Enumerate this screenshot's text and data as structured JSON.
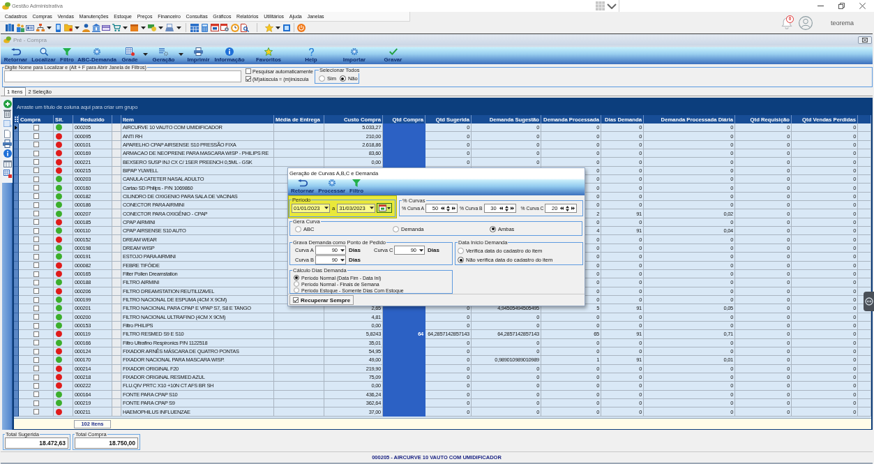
{
  "app": {
    "title": "Gestão Administrativa",
    "menu": [
      "Cadastros",
      "Compras",
      "Vendas",
      "Manutenções",
      "Estoque",
      "Preços",
      "Financeiro",
      "Consultas",
      "Gráficos",
      "Relatórios",
      "Utilitários",
      "Ajuda",
      "Janelas"
    ],
    "notifications": "0",
    "user": "teorema"
  },
  "window": {
    "title": "Pré - Compra",
    "toolbar": [
      {
        "label": "Retornar",
        "dropdown": false
      },
      {
        "label": "Localizar",
        "dropdown": false
      },
      {
        "label": "Filtro",
        "dropdown": false
      },
      {
        "label": "ABC-Demanda",
        "dropdown": false
      },
      {
        "label": "Grade",
        "dropdown": true
      },
      {
        "label": "Geração",
        "dropdown": true
      },
      {
        "label": "Imprimir",
        "dropdown": false
      },
      {
        "label": "Informação",
        "dropdown": false
      },
      {
        "label": "Favoritos",
        "dropdown": false
      },
      {
        "label": "Help",
        "dropdown": false
      },
      {
        "label": "Importar",
        "dropdown": false
      },
      {
        "label": "Gravar",
        "dropdown": false
      }
    ],
    "search": {
      "label": "Digite Nome para Localizar e (Alt + F para Abrir Janela de Filtros)"
    },
    "options": [
      {
        "label": "Pesquisar automaticamente",
        "checked": false
      },
      {
        "label": "(M)aiúscula = (m)inúscula",
        "checked": true
      }
    ],
    "select_all": {
      "title": "Selecionar Todos",
      "options": [
        {
          "label": "Sim",
          "selected": false
        },
        {
          "label": "Não",
          "selected": true
        }
      ]
    },
    "tabs": [
      {
        "label": "1 Itens",
        "selected": true
      },
      {
        "label": "2 Seleção",
        "selected": false
      }
    ],
    "grid": {
      "group_hint": "Arraste um título de coluna aqui para criar um grupo",
      "columns": [
        "Compra",
        "Sit.",
        "Reduzido",
        "Item",
        "Média de Entrega",
        "Custo Compra",
        "Qtd Compra",
        "Qtd Sugerida",
        "Demanda Sugestão",
        "Demanda Processada",
        "Dias Demanda",
        "Demanda Processada Diária",
        "Qtd Requisição",
        "Qtd Vendas Perdidas"
      ],
      "rows": [
        {
          "selected": true,
          "checked": false,
          "color": "#3cae2c",
          "cells": [
            "",
            "",
            "000205",
            "AIRCURVE 10 VAUTO COM UMIDIFICADOR",
            "",
            "5.033,27",
            "",
            "0",
            "0",
            "0",
            "0",
            "0",
            "0",
            "0"
          ]
        },
        {
          "selected": false,
          "checked": false,
          "color": "#e01b1b",
          "cells": [
            "",
            "",
            "000095",
            "ANTI RH",
            "",
            "210,00",
            "",
            "0",
            "0",
            "0",
            "0",
            "0",
            "0",
            "0"
          ]
        },
        {
          "selected": false,
          "checked": false,
          "color": "#e01b1b",
          "cells": [
            "",
            "",
            "000101",
            "APARELHO CPAP AIRSENSE S10 PRESSÃO FIXA",
            "",
            "2.618,86",
            "",
            "0",
            "0",
            "0",
            "0",
            "0",
            "0",
            "0"
          ]
        },
        {
          "selected": false,
          "checked": false,
          "color": "#e01b1b",
          "cells": [
            "",
            "",
            "000169",
            "ARMACAO DE NEOPRENE PARA MASCARA WISP - PHILIPS RE",
            "",
            "83,60",
            "",
            "0",
            "0",
            "0",
            "0",
            "0",
            "0",
            "0"
          ]
        },
        {
          "selected": false,
          "checked": false,
          "color": "#e01b1b",
          "cells": [
            "",
            "",
            "000221",
            "BEXSERO SUSP INJ CX C/ 1SER PREENCH 0,5ML - GSK",
            "",
            "0,00",
            "",
            "0",
            "0",
            "0",
            "0",
            "0",
            "0",
            "0"
          ]
        },
        {
          "selected": false,
          "checked": false,
          "color": "#e01b1b",
          "cells": [
            "",
            "",
            "000215",
            "BIPAP YUWELL",
            "",
            "",
            "",
            "",
            "",
            "0",
            "0",
            "0",
            "0",
            "0"
          ]
        },
        {
          "selected": false,
          "checked": false,
          "color": "#3cae2c",
          "cells": [
            "",
            "",
            "000203",
            "CANULA CATETER NASAL ADULTO",
            "",
            "",
            "",
            "",
            "",
            "0",
            "0",
            "0",
            "0",
            "0"
          ]
        },
        {
          "selected": false,
          "checked": false,
          "color": "#3cae2c",
          "cells": [
            "",
            "",
            "000160",
            "Cartao SD Philips - P/N 1069860",
            "",
            "",
            "",
            "",
            "",
            "0",
            "0",
            "0",
            "0",
            "0"
          ]
        },
        {
          "selected": false,
          "checked": false,
          "color": "#3cae2c",
          "cells": [
            "",
            "",
            "000182",
            "CILINDRO DE OXIGENIO PARA SALA DE VACINAS",
            "",
            "",
            "",
            "",
            "",
            "0",
            "0",
            "0",
            "0",
            "0"
          ]
        },
        {
          "selected": false,
          "checked": false,
          "color": "#3cae2c",
          "cells": [
            "",
            "",
            "000186",
            "CONECTOR PARA AIRMINI",
            "",
            "",
            "",
            "",
            "",
            "0",
            "0",
            "0",
            "0",
            "0"
          ]
        },
        {
          "selected": false,
          "checked": false,
          "color": "#3cae2c",
          "cells": [
            "",
            "",
            "000207",
            "CONECTOR PARA OXIGÊNIO - CPAP",
            "",
            "",
            "",
            "",
            "",
            "2",
            "91",
            "0,02",
            "0",
            "0"
          ]
        },
        {
          "selected": false,
          "checked": false,
          "color": "#e01b1b",
          "cells": [
            "",
            "",
            "000185",
            "CPAP AIRMINI",
            "",
            "",
            "",
            "",
            "",
            "0",
            "0",
            "0",
            "0",
            "0"
          ]
        },
        {
          "selected": false,
          "checked": false,
          "color": "#3cae2c",
          "cells": [
            "",
            "",
            "000110",
            "CPAP AIRSENSE S10 AUTO",
            "",
            "",
            "",
            "",
            "",
            "4",
            "91",
            "0,04",
            "0",
            "0"
          ]
        },
        {
          "selected": false,
          "checked": false,
          "color": "#e01b1b",
          "cells": [
            "",
            "",
            "000152",
            "DREAM WEAR",
            "",
            "",
            "",
            "",
            "",
            "0",
            "0",
            "0",
            "0",
            "0"
          ]
        },
        {
          "selected": false,
          "checked": false,
          "color": "#3cae2c",
          "cells": [
            "",
            "",
            "000198",
            "DREAM WISP",
            "",
            "",
            "",
            "",
            "",
            "0",
            "0",
            "0",
            "0",
            "0"
          ]
        },
        {
          "selected": false,
          "checked": false,
          "color": "#3cae2c",
          "cells": [
            "",
            "",
            "000191",
            "ESTOJO PARA AIRMINI",
            "",
            "",
            "",
            "",
            "",
            "0",
            "0",
            "0",
            "0",
            "0"
          ]
        },
        {
          "selected": false,
          "checked": false,
          "color": "#e01b1b",
          "cells": [
            "",
            "",
            "000082",
            "FEBRE TIFÓIDE",
            "",
            "",
            "",
            "",
            "",
            "0",
            "0",
            "0",
            "0",
            "0"
          ]
        },
        {
          "selected": false,
          "checked": false,
          "color": "#e01b1b",
          "cells": [
            "",
            "",
            "000165",
            "Filter Pollen Dreamstation",
            "",
            "",
            "",
            "",
            "",
            "0",
            "0",
            "0",
            "0",
            "0"
          ]
        },
        {
          "selected": false,
          "checked": false,
          "color": "#3cae2c",
          "cells": [
            "",
            "",
            "000188",
            "FILTRO AIRMINI",
            "",
            "",
            "",
            "",
            "",
            "0",
            "0",
            "0",
            "0",
            "0"
          ]
        },
        {
          "selected": false,
          "checked": false,
          "color": "#e01b1b",
          "cells": [
            "",
            "",
            "000206",
            "FILTRO DREAMSTATION REUTILIZAVEL",
            "",
            "",
            "",
            "",
            "",
            "0",
            "0",
            "0",
            "0",
            "0"
          ]
        },
        {
          "selected": false,
          "checked": false,
          "color": "#3cae2c",
          "cells": [
            "",
            "",
            "000199",
            "FILTRO NACIONAL DE ESPUMA (4CM X 9CM)",
            "",
            "",
            "",
            "",
            "",
            "0",
            "0",
            "0",
            "0",
            "0"
          ]
        },
        {
          "selected": false,
          "checked": false,
          "color": "#3cae2c",
          "cells": [
            "",
            "",
            "000201",
            "FILTRO NACIONAL PARA CPAP E VPAP S7, S8 E TANGO",
            "",
            "2,65",
            "",
            "0",
            "4,94505494505495",
            "5",
            "91",
            "0,05",
            "0",
            "0"
          ]
        },
        {
          "selected": false,
          "checked": false,
          "color": "#3cae2c",
          "cells": [
            "",
            "",
            "000200",
            "FILTRO NACIONAL ULTRAFINO (4CM X 9CM)",
            "",
            "4,81",
            "",
            "0",
            "0",
            "0",
            "0",
            "0",
            "0",
            "0"
          ]
        },
        {
          "selected": false,
          "checked": false,
          "color": "#3cae2c",
          "cells": [
            "",
            "",
            "000153",
            "Filtro PHILIPS",
            "",
            "0,00",
            "",
            "0",
            "0",
            "0",
            "0",
            "0",
            "0",
            "0"
          ]
        },
        {
          "selected": false,
          "checked": false,
          "color": "#e01b1b",
          "cells": [
            "",
            "",
            "000119",
            "FILTRO RESMED S9 E S10",
            "",
            "5,8243",
            "64",
            "64,2857142857143",
            "64,2857142857143",
            "65",
            "91",
            "0,71",
            "0",
            "0"
          ]
        },
        {
          "selected": false,
          "checked": false,
          "color": "#3cae2c",
          "cells": [
            "",
            "",
            "000166",
            "Filtro Ultrafino Respironics P/N 1122518",
            "",
            "35,01",
            "",
            "0",
            "0",
            "0",
            "0",
            "0",
            "0",
            "0"
          ]
        },
        {
          "selected": false,
          "checked": false,
          "color": "#e01b1b",
          "cells": [
            "",
            "",
            "000124",
            "FIXADOR ARNÊS MÁSCARA DE QUATRO PONTAS",
            "",
            "54,95",
            "",
            "0",
            "0",
            "0",
            "0",
            "0",
            "0",
            "0"
          ]
        },
        {
          "selected": false,
          "checked": false,
          "color": "#3cae2c",
          "cells": [
            "",
            "",
            "000170",
            "FIXADOR NACIONAL PARA MASCARA WISP.",
            "",
            "49,00",
            "",
            "0",
            "0,989010989010989",
            "1",
            "91",
            "0,01",
            "0",
            "0"
          ]
        },
        {
          "selected": false,
          "checked": false,
          "color": "#e01b1b",
          "cells": [
            "",
            "",
            "000214",
            "FIXADOR ORIGINAL F20",
            "",
            "219,90",
            "",
            "0",
            "0",
            "0",
            "0",
            "0",
            "0",
            "0"
          ]
        },
        {
          "selected": false,
          "checked": false,
          "color": "#e01b1b",
          "cells": [
            "",
            "",
            "000218",
            "FIXADOR ORIGINAL RESMED AZUL",
            "",
            "75,09",
            "",
            "0",
            "0",
            "0",
            "0",
            "0",
            "0",
            "0"
          ]
        },
        {
          "selected": false,
          "checked": false,
          "color": "#e01b1b",
          "cells": [
            "",
            "",
            "000222",
            "FLU.QIV PRTC X10 +10N CT AFS BR SH",
            "",
            "0,00",
            "",
            "0",
            "0",
            "0",
            "0",
            "0",
            "0",
            "0"
          ]
        },
        {
          "selected": false,
          "checked": false,
          "color": "#3cae2c",
          "cells": [
            "",
            "",
            "000164",
            "FONTE PARA CPAP S10",
            "",
            "436,24",
            "",
            "0",
            "0",
            "0",
            "0",
            "0",
            "0",
            "0"
          ]
        },
        {
          "selected": false,
          "checked": false,
          "color": "#3cae2c",
          "cells": [
            "",
            "",
            "000219",
            "FONTE PARA CPAP S9",
            "",
            "362,64",
            "",
            "0",
            "0",
            "0",
            "0",
            "0",
            "0",
            "0"
          ]
        },
        {
          "selected": false,
          "checked": false,
          "color": "#e01b1b",
          "cells": [
            "",
            "",
            "000211",
            "HAEMOPHILUS INFLUENZAE",
            "",
            "37,00",
            "",
            "0",
            "0",
            "0",
            "0",
            "0",
            "0",
            "0"
          ]
        }
      ],
      "footer": "102 Itens"
    },
    "totals": [
      {
        "label": "Total Sugerida",
        "value": "18.472,63"
      },
      {
        "label": "Total Compra",
        "value": "18.750,00"
      }
    ],
    "status_bar": "000205 - AIRCURVE 10 VAUTO COM UMIDIFICADOR"
  },
  "dialog": {
    "title": "Geração de Curvas A,B,C e Demanda",
    "toolbar": [
      "Retornar",
      "Processar",
      "Filtro"
    ],
    "period": {
      "title": "Período",
      "from": "01/01/2023",
      "separator": "a",
      "to": "31/03/2023",
      "highlighted": true
    },
    "curves": {
      "title": "% Curvas",
      "fields": [
        {
          "label": "% Curva A",
          "value": "50"
        },
        {
          "label": "% Curva B",
          "value": "30"
        },
        {
          "label": "% Curva C",
          "value": "20"
        }
      ]
    },
    "curve_type": {
      "title": "Gera Curva",
      "options": [
        {
          "label": "ABC",
          "selected": false
        },
        {
          "label": "Demanda",
          "selected": false
        },
        {
          "label": "Ambas",
          "selected": true
        }
      ]
    },
    "reorder_point": {
      "title": "Grava Demanda como Ponto de Pedido",
      "fields": [
        {
          "label": "Curva A",
          "value": "90",
          "unit": "Dias"
        },
        {
          "label": "Curva C",
          "value": "90",
          "unit": "Dias"
        },
        {
          "label": "Curva B",
          "value": "90",
          "unit": "Dias"
        }
      ]
    },
    "demand_start": {
      "title": "Data Início Demanda",
      "options": [
        {
          "label": "Verifica data do cadastro do item",
          "selected": false
        },
        {
          "label": "Não verifica data do cadastro do item",
          "selected": true
        }
      ]
    },
    "days_calc": {
      "title": "Cálculo Dias Demanda",
      "options": [
        {
          "label": "Período Normal (Data Fim - Data Ini)",
          "selected": true
        },
        {
          "label": "Período Normal - Finais de Semana",
          "selected": false
        },
        {
          "label": "Período Estoque - Somente Dias Com Estoque",
          "selected": false
        }
      ]
    },
    "always_recover": {
      "label": "Recuperar Sempre",
      "checked": true
    }
  }
}
